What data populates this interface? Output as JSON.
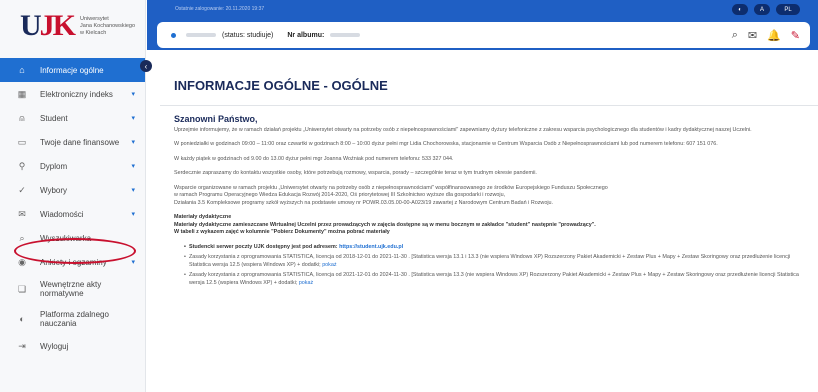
{
  "logo": {
    "mark_blue": "U",
    "mark_red": "JK",
    "lines": [
      "Uniwersytet",
      "Jana Kochanowskiego",
      "w Kielcach"
    ]
  },
  "sidebar": {
    "items": [
      {
        "label": "Informacje ogólne",
        "icon": "home-icon",
        "glyph": "⌂",
        "chev": ""
      },
      {
        "label": "Elektroniczny indeks",
        "icon": "grid-icon",
        "glyph": "▦",
        "chev": "▾"
      },
      {
        "label": "Student",
        "icon": "person-icon",
        "glyph": "⍝",
        "chev": "▾"
      },
      {
        "label": "Twoje dane finansowe",
        "icon": "money-icon",
        "glyph": "▭",
        "chev": "▾"
      },
      {
        "label": "Dyplom",
        "icon": "diploma-icon",
        "glyph": "⚲",
        "chev": "▾"
      },
      {
        "label": "Wybory",
        "icon": "check-icon",
        "glyph": "✓",
        "chev": "▾"
      },
      {
        "label": "Wiadomości",
        "icon": "mail-icon",
        "glyph": "✉",
        "chev": "▾"
      },
      {
        "label": "Wyszukiwarka",
        "icon": "search-icon",
        "glyph": "⌕",
        "chev": ""
      },
      {
        "label": "Ankiety i egzaminy",
        "icon": "survey-icon",
        "glyph": "◉",
        "chev": "▾"
      },
      {
        "label": "Wewnętrzne akty normatywne",
        "icon": "document-icon",
        "glyph": "❏",
        "chev": ""
      },
      {
        "label": "Platforma zdalnego nauczania",
        "icon": "platform-icon",
        "glyph": "◐",
        "chev": ""
      },
      {
        "label": "Wyloguj",
        "icon": "logout-icon",
        "glyph": "⇥",
        "chev": ""
      }
    ]
  },
  "topbar": {
    "session": "Ostatnie zalogowanie: 20.11.2020 19:37",
    "pills": [
      "◐",
      "A",
      "PL"
    ]
  },
  "userbar": {
    "status": "(status: studiuje)",
    "album_label": "Nr albumu:",
    "icons": [
      "⌕",
      "✉",
      "🔔",
      "✎"
    ]
  },
  "main": {
    "title": "INFORMACJE OGÓLNE - OGÓLNE",
    "greeting": "Szanowni Państwo,",
    "p1": "Uprzejmie informujemy, że w ramach działań projektu „Uniwersytet otwarty na potrzeby osób z niepełnosprawnościami\" zapewniamy dyżury telefoniczne z zakresu wsparcia psychologicznego dla studentów i kadry dydaktycznej naszej Uczelni.",
    "p2": "W poniedziałki w godzinach 09:00 – 11:00 oraz czwartki w godzinach 8:00 – 10:00 dyżur pełni mgr Lidia Chochorowska, stacjonarnie w Centrum Wsparcia Osób z Niepełnosprawnościami lub pod numerem telefonu: 607 151 076.",
    "p3": "W każdy piątek w godzinach od 9.00 do 13.00 dyżur pełni mgr Joanna Woźniak pod numerem telefonu: 533 327 044.",
    "p4": "Serdecznie zapraszamy do kontaktu wszystkie osoby, które potrzebują rozmowy, wsparcia, porady – szczególnie teraz w tym trudnym okresie pandemii.",
    "p5a": "Wsparcie organizowane w ramach projektu „Uniwersytet otwarty na potrzeby osób z niepełnosprawnościami\" współfinansowanego ze środków Europejskiego Funduszu Społecznego",
    "p5b": "w ramach Programu Operacyjnego Wiedza Edukacja Rozwój 2014-2020, Oś priorytetowej III Szkolnictwo wyższe dla gospodarki i rozwoju,",
    "p5c": "Działania 3.5 Kompleksowe programy szkół wyższych na podstawie umowy nr POWR.03.05.00-00-A023/19 zawartej z Narodowym Centrum Badań i Rozwoju.",
    "mat_head": "Materiały dydaktyczne",
    "mat_line1": "Materiały dydaktyczne zamieszczane Wirtualnej Uczelni przez prowadzących w zajęcia dostępne są w menu bocznym w zakładce \"student\" następnie \"prowadzący\".",
    "mat_line2": "W tabeli z wykazem zajęć w kolumnie \"Pobierz Dokumenty\" można pobrać materiały",
    "bullet1_text": "Studencki serwer poczty UJK dostępny jest pod adresem: ",
    "bullet1_link": "https://student.ujk.edu.pl",
    "bullet2_text": "Zasady korzystania z oprogramowania STATISTICA, licencja od 2018-12-01 do 2021-11-30 . [Statistica wersja 13.1 i 13.3 (nie wspiera Windows XP) Rozszerzony Pakiet Akademicki + Zestaw Plus + Mapy + Zestaw Skoringowy oraz przedłużenie licencji Statistica wersja 12.5 (wspiera Windows XP) + dodatki; ",
    "bullet2_link": "pokaż",
    "bullet3_text": "Zasady korzystania z oprogramowania STATISTICA, licencja od 2021-12-01 do 2024-11-30 . [Statistica wersja 13.3 (nie wspiera Windows XP) Rozszerzony Pakiet Akademicki + Zestaw Plus + Mapy + Zestaw Skoringowy oraz przedłużenie licencji Statistica wersja 12.5 (wspiera Windows XP) + dodatki; ",
    "bullet3_link": "pokaż"
  },
  "colors": {
    "primary": "#1f6fd1",
    "topbar": "#1f5fc4",
    "navy": "#1a2a5a",
    "annotation": "#c8102e"
  }
}
